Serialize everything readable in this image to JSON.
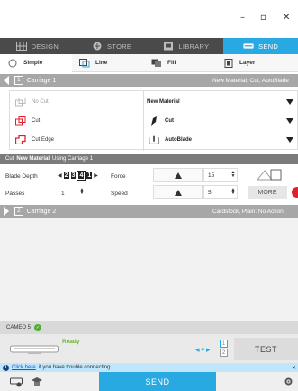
{
  "window": {
    "minimize": "–",
    "maximize": "▫",
    "close": "✕"
  },
  "tabs": [
    {
      "label": "DESIGN",
      "icon": "design-grid-icon",
      "active": false
    },
    {
      "label": "STORE",
      "icon": "store-icon",
      "active": false
    },
    {
      "label": "LIBRARY",
      "icon": "library-icon",
      "active": false
    },
    {
      "label": "SEND",
      "icon": "send-cutter-icon",
      "active": true
    }
  ],
  "subtabs": [
    {
      "label": "Simple",
      "icon": "radio-icon",
      "active": true
    },
    {
      "label": "Line",
      "icon": "line-icon",
      "active": false
    },
    {
      "label": "Fill",
      "icon": "fill-icon",
      "active": false
    },
    {
      "label": "Layer",
      "icon": "layer-icon",
      "active": false
    }
  ],
  "carriage1": {
    "number": "1",
    "label": "Carriage 1",
    "material_summary": "New Material: Cut, AutoBlade"
  },
  "cut_options": [
    {
      "label": "No Cut",
      "icon": "no-cut-icon"
    },
    {
      "label": "Cut",
      "icon": "cut-icon"
    },
    {
      "label": "Cut Edge",
      "icon": "cut-edge-icon"
    }
  ],
  "dropdowns": {
    "material": "New Material",
    "action": "Cut",
    "tool": "AutoBlade"
  },
  "cut_settings": {
    "prefix": "Cut",
    "material": "New Material",
    "suffix": "Using Carriage 1",
    "blade_depth_label": "Blade Depth",
    "blade_digits": [
      "2",
      "3",
      "4",
      "1"
    ],
    "force_label": "Force",
    "force_value": "15",
    "passes_label": "Passes",
    "passes_value": "1",
    "speed_label": "Speed",
    "speed_value": "5",
    "more_label": "MORE"
  },
  "carriage2": {
    "number": "2",
    "label": "Carriage 2",
    "material_summary": "Cardstock, Plain: No Action"
  },
  "machine": {
    "name": "CAMEO 5",
    "status": "Ready"
  },
  "pager": {
    "page1": "1",
    "page2": "2"
  },
  "test_label": "TEST",
  "help": {
    "link": "Click here",
    "text": "if you have trouble connecting.",
    "close": "✕"
  },
  "send_label": "SEND",
  "colors": {
    "accent": "#29a9e1",
    "ready": "#6ab22e",
    "alert": "#e0202a",
    "cut_red": "#e0202a"
  }
}
